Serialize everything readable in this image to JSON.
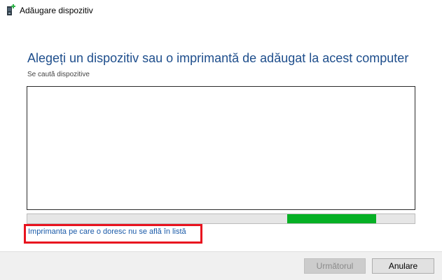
{
  "window": {
    "icon": "add-device-icon",
    "title": "Adăugare dispozitiv"
  },
  "main": {
    "heading": "Alegeți un dispozitiv sau o imprimantă de adăugat la acest computer",
    "status": "Se caută dispozitive",
    "devices": [],
    "progress": {
      "start_fraction": 0.67,
      "end_fraction": 0.9
    },
    "missing_printer_link": "Imprimanta pe care o doresc nu se află în listă"
  },
  "footer": {
    "next_label": "Următorul",
    "cancel_label": "Anulare"
  },
  "colors": {
    "heading": "#1e4e8c",
    "link": "#1a5aa8",
    "progress": "#06b025",
    "highlight": "#e8131f"
  }
}
